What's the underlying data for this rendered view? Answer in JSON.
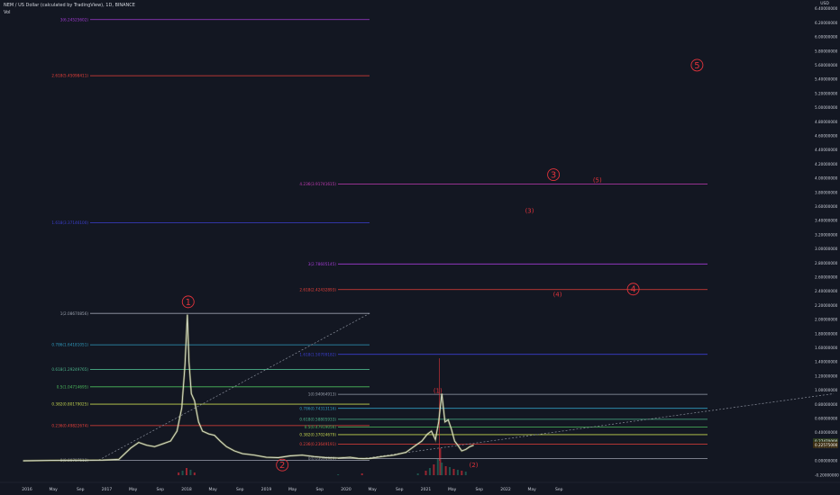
{
  "header": {
    "title": "NEM / US Dollar (calculated by TradingView), 1D, BINANCE",
    "volume_label": "Vol"
  },
  "colors": {
    "background": "#131722",
    "price_line": "#d8e0d0",
    "price_glow": "#f2f07a",
    "wave_label": "#e0333b",
    "trend_line": "#8a8f9c",
    "volume_down": "#b22833",
    "volume_up": "#1f5f55",
    "axis_text": "#c8ccd6"
  },
  "chart_data": {
    "type": "line",
    "title": "NEM / US Dollar (calculated by TradingView), 1D, BINANCE",
    "xlabel": "",
    "ylabel": "USD",
    "ylim": [
      -0.3,
      6.45
    ],
    "grid": false,
    "y_axis": {
      "unit": "USD",
      "ticks": [
        "6.40000000",
        "6.20000000",
        "6.00000000",
        "5.80000000",
        "5.60000000",
        "5.40000000",
        "5.20000000",
        "5.00000000",
        "4.80000000",
        "4.60000000",
        "4.40000000",
        "4.20000000",
        "4.00000000",
        "3.80000000",
        "3.60000000",
        "3.40000000",
        "3.20000000",
        "3.00000000",
        "2.80000000",
        "2.60000000",
        "2.40000000",
        "2.20000000",
        "2.00000000",
        "1.80000000",
        "1.60000000",
        "1.40000000",
        "1.20000000",
        "1.00000000",
        "0.80000000",
        "0.60000000",
        "0.40000000",
        "0.20000000",
        "0.00000000",
        "-0.20000000"
      ],
      "current_price_badges": [
        {
          "label": "0.27470000",
          "value": 0.2747,
          "color": "#2b3a1f"
        },
        {
          "label": "0.22575000",
          "value": 0.2258,
          "color": "#3b2d12"
        }
      ]
    },
    "x_axis": {
      "ticks": [
        {
          "label": "2016",
          "x": 2016.0
        },
        {
          "label": "May",
          "x": 2016.33
        },
        {
          "label": "Sep",
          "x": 2016.67
        },
        {
          "label": "2017",
          "x": 2017.0
        },
        {
          "label": "May",
          "x": 2017.33
        },
        {
          "label": "Sep",
          "x": 2017.67
        },
        {
          "label": "2018",
          "x": 2018.0
        },
        {
          "label": "May",
          "x": 2018.33
        },
        {
          "label": "Sep",
          "x": 2018.67
        },
        {
          "label": "2019",
          "x": 2019.0
        },
        {
          "label": "May",
          "x": 2019.33
        },
        {
          "label": "Sep",
          "x": 2019.67
        },
        {
          "label": "2020",
          "x": 2020.0
        },
        {
          "label": "May",
          "x": 2020.33
        },
        {
          "label": "Sep",
          "x": 2020.67
        },
        {
          "label": "2021",
          "x": 2021.0
        },
        {
          "label": "May",
          "x": 2021.33
        },
        {
          "label": "Sep",
          "x": 2021.67
        },
        {
          "label": "2022",
          "x": 2022.0
        },
        {
          "label": "May",
          "x": 2022.33
        },
        {
          "label": "Sep",
          "x": 2022.67
        }
      ]
    },
    "price_series": {
      "name": "",
      "x": [
        2015.95,
        2016.3,
        2016.7,
        2016.95,
        2017.15,
        2017.3,
        2017.4,
        2017.5,
        2017.6,
        2017.7,
        2017.8,
        2017.88,
        2017.94,
        2017.98,
        2018.01,
        2018.03,
        2018.06,
        2018.1,
        2018.15,
        2018.2,
        2018.28,
        2018.35,
        2018.42,
        2018.5,
        2018.6,
        2018.7,
        2018.85,
        2019.0,
        2019.15,
        2019.3,
        2019.45,
        2019.6,
        2019.75,
        2019.9,
        2020.05,
        2020.15,
        2020.22,
        2020.3,
        2020.45,
        2020.6,
        2020.75,
        2020.85,
        2020.95,
        2021.02,
        2021.07,
        2021.12,
        2021.16,
        2021.2,
        2021.24,
        2021.28,
        2021.32,
        2021.36,
        2021.4,
        2021.45,
        2021.5,
        2021.55,
        2021.6
      ],
      "y": [
        0.0,
        0.005,
        0.008,
        0.01,
        0.02,
        0.18,
        0.26,
        0.22,
        0.2,
        0.24,
        0.28,
        0.42,
        0.75,
        1.35,
        2.07,
        1.4,
        0.95,
        0.85,
        0.55,
        0.42,
        0.38,
        0.36,
        0.28,
        0.2,
        0.14,
        0.1,
        0.08,
        0.05,
        0.045,
        0.07,
        0.08,
        0.06,
        0.045,
        0.04,
        0.05,
        0.035,
        0.03,
        0.035,
        0.06,
        0.08,
        0.12,
        0.2,
        0.28,
        0.38,
        0.42,
        0.3,
        0.55,
        0.95,
        0.55,
        0.58,
        0.45,
        0.28,
        0.22,
        0.14,
        0.16,
        0.2,
        0.22
      ]
    },
    "volume": {
      "x": [
        2017.9,
        2017.95,
        2018.0,
        2018.05,
        2018.1,
        2019.9,
        2020.2,
        2020.9,
        2021.0,
        2021.05,
        2021.1,
        2021.15,
        2021.18,
        2021.2,
        2021.25,
        2021.3,
        2021.35,
        2021.4,
        2021.45,
        2021.5
      ],
      "values": [
        3,
        5,
        8,
        6,
        3,
        1,
        2,
        2,
        5,
        8,
        12,
        18,
        30,
        14,
        10,
        9,
        7,
        6,
        5,
        4
      ]
    },
    "fib_set_1": [
      {
        "label": "0(0.00707513)",
        "value": 0.007,
        "color": "#888c99"
      },
      {
        "label": "0.236(0.49822674)",
        "value": 0.498,
        "color": "#e8403a"
      },
      {
        "label": "0.382(0.80179025)",
        "value": 0.802,
        "color": "#c5d650"
      },
      {
        "label": "0.5(1.04714695)",
        "value": 1.047,
        "color": "#4cbb5c"
      },
      {
        "label": "0.618(1.29249765)",
        "value": 1.292,
        "color": "#4cb38a"
      },
      {
        "label": "0.786(1.64181051)",
        "value": 1.642,
        "color": "#2f9bbf"
      },
      {
        "label": "1(2.08670856)",
        "value": 2.087,
        "color": "#9aa0ad"
      },
      {
        "label": "1.618(3.37146100)",
        "value": 3.371,
        "color": "#3b3fd0"
      },
      {
        "label": "2.618(5.45098411)",
        "value": 5.451,
        "color": "#e8403a"
      },
      {
        "label": "3(6.24525602)",
        "value": 6.245,
        "color": "#a23bd4"
      }
    ],
    "fib_set_2": [
      {
        "label": "0(0.03094949)",
        "value": 0.031,
        "color": "#888c99"
      },
      {
        "label": "0.236(0.23649191)",
        "value": 0.236,
        "color": "#e8403a"
      },
      {
        "label": "0.382(0.37024679)",
        "value": 0.37,
        "color": "#c5d650"
      },
      {
        "label": "0.5(0.47919056)",
        "value": 0.479,
        "color": "#4cbb5c"
      },
      {
        "label": "0.618(0.58805933)",
        "value": 0.588,
        "color": "#4cb38a"
      },
      {
        "label": "0.786(0.74313116)",
        "value": 0.743,
        "color": "#2f9bbf"
      },
      {
        "label": "1(0.94064913)",
        "value": 0.941,
        "color": "#9aa0ad"
      },
      {
        "label": "1.618(1.50709182)",
        "value": 1.507,
        "color": "#3b3fd0"
      },
      {
        "label": "2.618(2.42432893)",
        "value": 2.424,
        "color": "#e8403a"
      },
      {
        "label": "3(2.78605145)",
        "value": 2.786,
        "color": "#a23bd4"
      },
      {
        "label": "4.236(3.91741615)",
        "value": 3.917,
        "color": "#c23bb4"
      }
    ],
    "wave_labels": [
      {
        "label": "1",
        "circled": true,
        "x": 2018.02,
        "y": 2.25
      },
      {
        "label": "2",
        "circled": true,
        "x": 2019.2,
        "y": -0.06
      },
      {
        "label": "3",
        "circled": true,
        "x": 2022.6,
        "y": 4.05
      },
      {
        "label": "4",
        "circled": true,
        "x": 2023.6,
        "y": 2.43
      },
      {
        "label": "5",
        "circled": true,
        "x": 2024.4,
        "y": 5.6
      },
      {
        "label": "(1)",
        "circled": false,
        "x": 2021.15,
        "y": 1.0
      },
      {
        "label": "(2)",
        "circled": false,
        "x": 2021.6,
        "y": -0.05
      },
      {
        "label": "(3)",
        "circled": false,
        "x": 2022.3,
        "y": 3.55
      },
      {
        "label": "(4)",
        "circled": false,
        "x": 2022.65,
        "y": 2.36
      },
      {
        "label": "(5)",
        "circled": false,
        "x": 2023.15,
        "y": 3.98
      }
    ]
  }
}
